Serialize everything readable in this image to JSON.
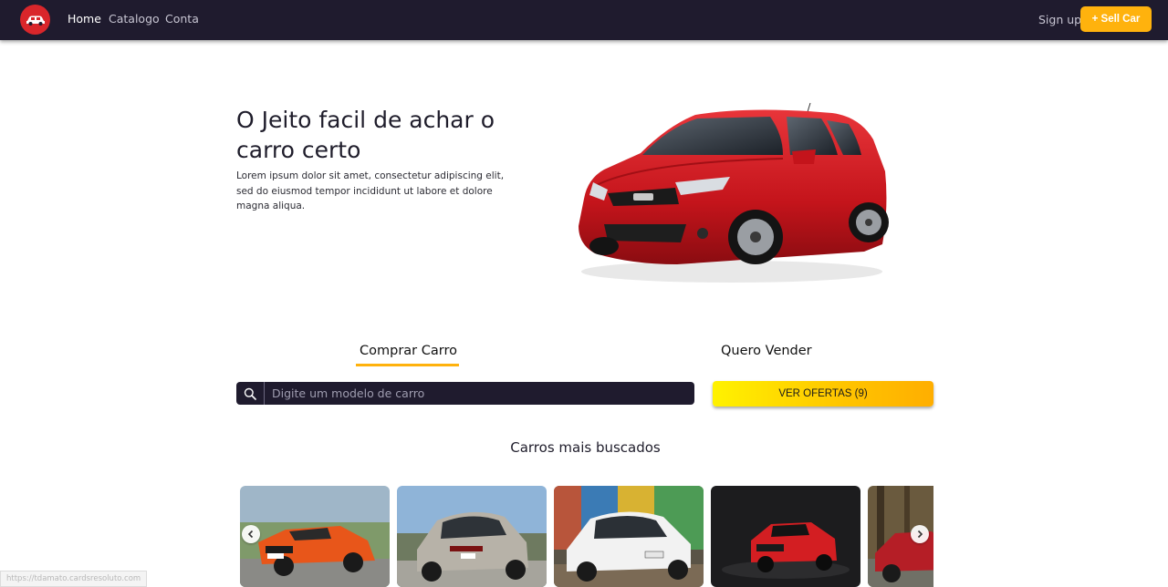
{
  "navbar": {
    "logo_icon": "car-logo-icon",
    "links": [
      {
        "label": "Home",
        "active": true
      },
      {
        "label": "Catalogo",
        "active": false
      },
      {
        "label": "Conta",
        "active": false
      }
    ],
    "signup_label": "Sign up",
    "sell_label": "+ Sell Car"
  },
  "hero": {
    "title": "O Jeito facil de achar o carro certo",
    "text": "Lorem ipsum dolor sit amet, consectetur adipiscing elit, sed do eiusmod tempor incididunt ut labore et dolore magna aliqua.",
    "image_icon": "red-hatchback-car-image"
  },
  "tabs": [
    {
      "label": "Comprar Carro",
      "active": true
    },
    {
      "label": "Quero Vender",
      "active": false
    }
  ],
  "search": {
    "icon": "search-icon",
    "value": "",
    "placeholder": "Digite um modelo de carro"
  },
  "offers_button": "VER OFERTAS (9)",
  "most_searched": {
    "title": "Carros mais buscados",
    "cards": [
      {
        "image": "orange-suv-convertible"
      },
      {
        "image": "silver-hatchback"
      },
      {
        "image": "white-sedan-graffiti"
      },
      {
        "image": "red-pickup-dark"
      },
      {
        "image": "red-car-forest"
      }
    ],
    "prev_icon": "chevron-left-icon",
    "next_icon": "chevron-right-icon"
  },
  "status_bar_url": "https://tdamato.cardsresoluto.com",
  "colors": {
    "navbar": "#1f1b2e",
    "accent": "#ffb20d",
    "logo": "#d9262b"
  }
}
